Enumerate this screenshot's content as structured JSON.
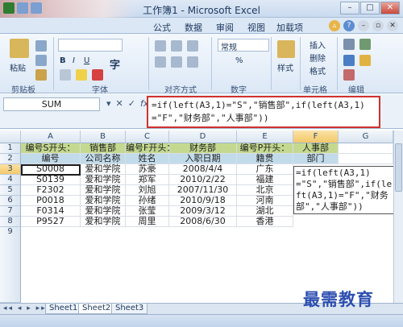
{
  "window": {
    "title": "工作簿1 - Microsoft Excel"
  },
  "ribbon_tabs": [
    "公式",
    "数据",
    "审阅",
    "视图",
    "加载项"
  ],
  "ribbon": {
    "paste": "粘贴",
    "font_label": "字",
    "bold": "B",
    "italic": "I",
    "underline": "U",
    "format_box": "常规",
    "percent": "%",
    "insert": "插入",
    "delete": "删除",
    "format": "格式",
    "styles": "样式",
    "groups": [
      "剪贴板",
      "字体",
      "对齐方式",
      "数字",
      "单元格",
      "编辑"
    ]
  },
  "formula_bar": {
    "name_box": "SUM",
    "icons": [
      "▾",
      "✕",
      "✓",
      "fx"
    ],
    "formula": "=if(left(A3,1)=\"S\",\"销售部\",if(left(A3,1)=\"F\",\"财务部\",\"人事部\"))"
  },
  "columns": [
    "A",
    "B",
    "C",
    "D",
    "E",
    "F",
    "G"
  ],
  "rows": [
    "1",
    "2",
    "3",
    "4",
    "5",
    "6",
    "7",
    "8",
    "9"
  ],
  "row1": [
    "编号S开头：",
    "销售部",
    "编号F开头：",
    "财务部",
    "编号P开头：",
    "人事部"
  ],
  "headers": [
    "编号",
    "公司名称",
    "姓名",
    "入职日期",
    "籍贯",
    "部门"
  ],
  "data": [
    [
      "S0008",
      "爱和学院",
      "苏豪",
      "2008/4/4",
      "广东"
    ],
    [
      "S0139",
      "爱和学院",
      "郑军",
      "2010/2/22",
      "福建"
    ],
    [
      "F2302",
      "爱和学院",
      "刘旭",
      "2007/11/30",
      "北京"
    ],
    [
      "P0018",
      "爱和学院",
      "孙绪",
      "2010/9/18",
      "河南"
    ],
    [
      "F0314",
      "爱和学院",
      "张莹",
      "2009/3/12",
      "湖北"
    ],
    [
      "P9527",
      "爱和学院",
      "周里",
      "2008/6/30",
      "香港"
    ]
  ],
  "edit_cell_text": "=if(left(A3,1)=\"S\",\"销售部\",if(left(A3,1)=\"F\",\"财务部\",\"人事部\"))",
  "sheets": [
    "Sheet1",
    "Sheet2",
    "Sheet3"
  ],
  "watermark": "最需教育"
}
